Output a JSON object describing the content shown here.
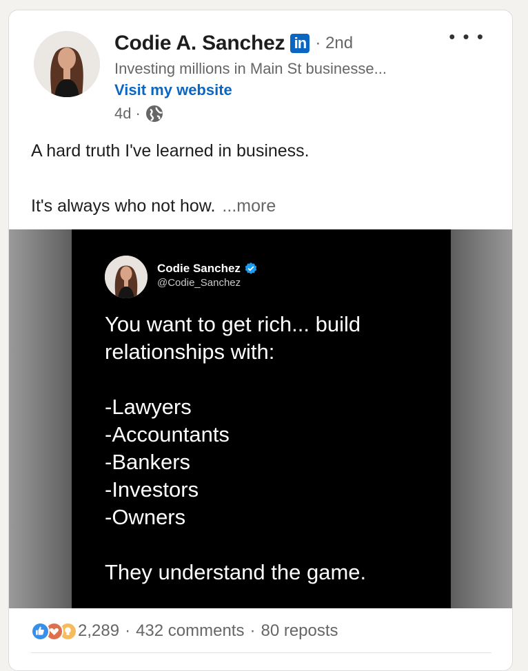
{
  "post": {
    "author": {
      "name": "Codie A. Sanchez",
      "degree": "2nd",
      "headline": "Investing millions in Main St businesse...",
      "website_link": "Visit my website",
      "time_ago": "4d",
      "badge": "in",
      "avatar_icon": "profile-photo"
    },
    "more_menu_icon": "more-horizontal-icon",
    "text_lines": [
      "A hard truth I've learned in business.",
      "It's always who not how."
    ],
    "see_more": "...more",
    "image": {
      "tweet_author": "Codie Sanchez",
      "tweet_handle": "@Codie_Sanchez",
      "body_lines": [
        "You want to get rich... build",
        "relationships with:",
        "",
        "-Lawyers",
        "-Accountants",
        "-Bankers",
        "-Investors",
        "-Owners",
        "",
        "They understand the game."
      ]
    },
    "social": {
      "reaction_count": "2,289",
      "comments": "432 comments",
      "reposts": "80 reposts",
      "reactions": [
        "like-icon",
        "love-icon",
        "insightful-icon"
      ]
    }
  },
  "colors": {
    "brand_blue": "#0a66c2",
    "text_primary": "#1d1d1d",
    "text_secondary": "#666666",
    "verified_blue": "#1d9bf0"
  }
}
